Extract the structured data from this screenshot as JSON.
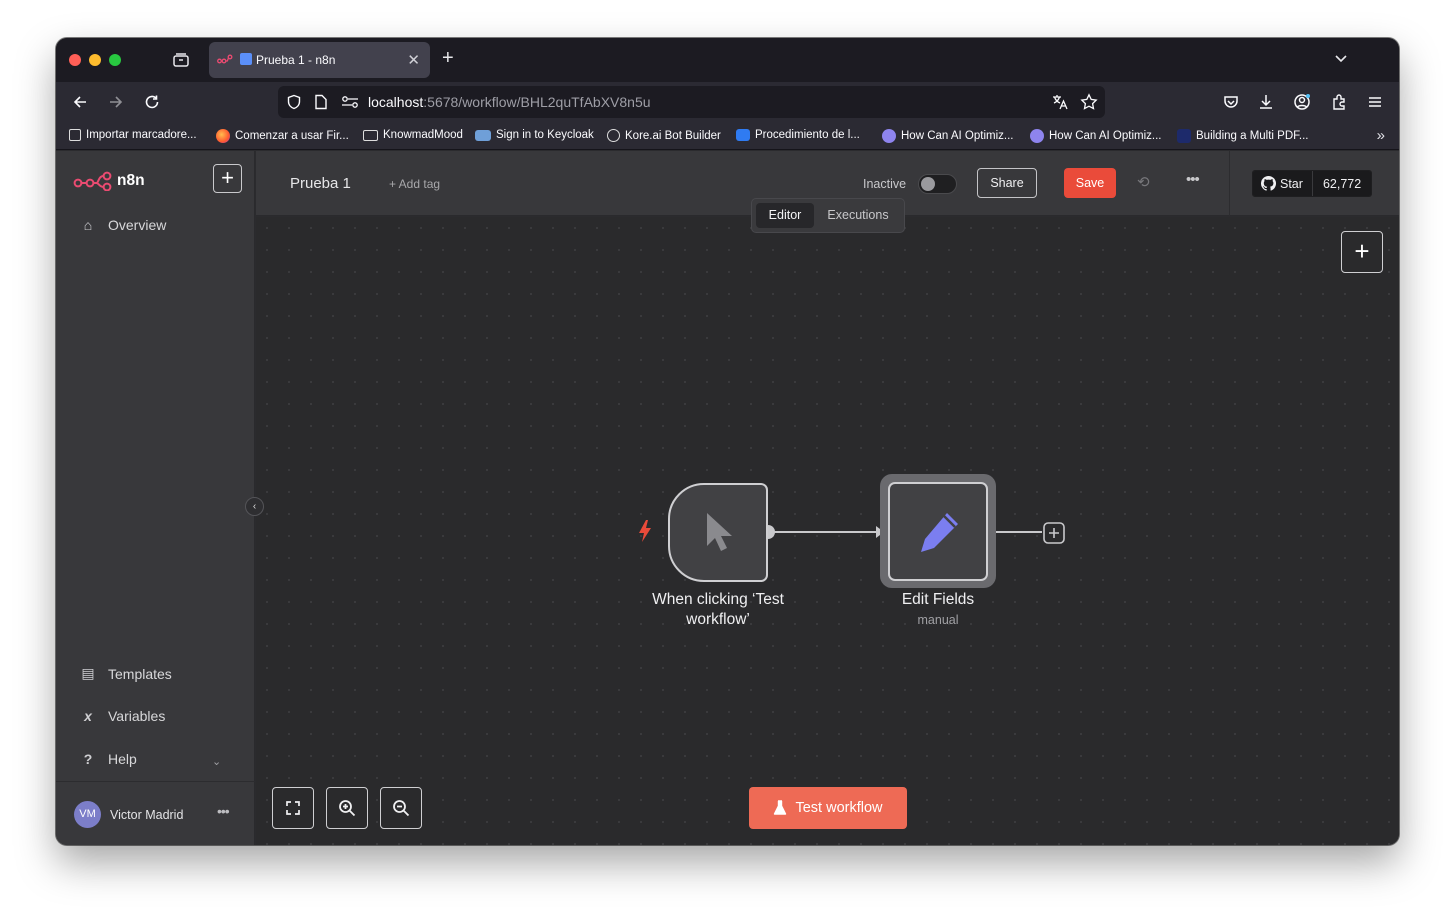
{
  "browser": {
    "tab_title": "Prueba 1 - n8n",
    "url_host": "localhost",
    "url_path": ":5678/workflow/BHL2quTfAbXV8n5u",
    "bookmarks": [
      "Importar marcadore...",
      "Comenzar a usar Fir...",
      "KnowmadMood",
      "Sign in to Keycloak",
      "Kore.ai Bot Builder",
      "Procedimiento de l...",
      "How Can AI Optimiz...",
      "How Can AI Optimiz...",
      "Building a Multi PDF..."
    ]
  },
  "sidebar": {
    "logo_text": "n8n",
    "overview": "Overview",
    "templates": "Templates",
    "variables": "Variables",
    "help": "Help",
    "user_initials": "VM",
    "user_name": "Victor Madrid"
  },
  "header": {
    "workflow_name": "Prueba 1",
    "add_tag": "+ Add tag",
    "status": "Inactive",
    "share": "Share",
    "save": "Save",
    "star": "Star",
    "star_count": "62,772"
  },
  "tabs": {
    "editor": "Editor",
    "executions": "Executions"
  },
  "nodes": {
    "trigger_label_line1": "When clicking ‘Test",
    "trigger_label_line2": "workflow’",
    "edit_label": "Edit Fields",
    "edit_sub": "manual"
  },
  "canvas": {
    "test_button": "Test workflow"
  },
  "colors": {
    "accent": "#ea4b3a",
    "test_button": "#ee6a55",
    "edit_icon": "#7b7ef0"
  }
}
